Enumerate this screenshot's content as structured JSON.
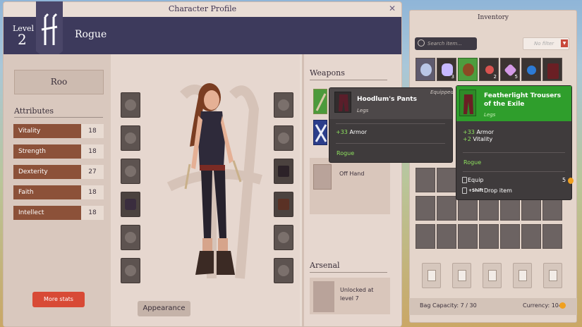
{
  "character_window": {
    "title": "Character Profile",
    "close": "✕",
    "level_label": "Level",
    "level_value": "2",
    "class_name": "Rogue",
    "name": "Roo",
    "attributes_title": "Attributes",
    "attributes": [
      {
        "label": "Vitality",
        "value": "18"
      },
      {
        "label": "Strength",
        "value": "18"
      },
      {
        "label": "Dexterity",
        "value": "27"
      },
      {
        "label": "Faith",
        "value": "18"
      },
      {
        "label": "Intellect",
        "value": "18"
      }
    ],
    "more_stats": "More stats",
    "appearance": "Appearance",
    "weapons_title": "Weapons",
    "off_hand": "Off Hand",
    "arsenal_title": "Arsenal",
    "arsenal_locked": "Unlocked at level 7"
  },
  "inventory": {
    "title": "Inventory",
    "search_placeholder": "Search item...",
    "filter": "No filter",
    "item_counts": [
      "",
      "3",
      "",
      "2",
      "5",
      "",
      ""
    ],
    "bag_capacity": "Bag Capacity: 7 / 30",
    "currency": "Currency: 104"
  },
  "tooltip_equipped": {
    "badge": "Equipped",
    "name": "Hoodlum's Pants",
    "slot": "Legs",
    "stat_value": "+33",
    "stat_label": "Armor",
    "class": "Rogue"
  },
  "tooltip_hovered": {
    "name": "Featherlight Trousers of the Exile",
    "slot": "Legs",
    "stat1_value": "+33",
    "stat1_label": "Armor",
    "stat2_value": "+2",
    "stat2_label": "Vitality",
    "class": "Rogue",
    "equip": "Equip",
    "price": "5",
    "drop_key": "+Shift",
    "drop": "Drop item"
  },
  "colors": {
    "header": "#3d3a5c",
    "attribute_bar": "#8c5139",
    "more_stats_button": "#d84a36",
    "green_rarity": "#2f9e2c"
  }
}
